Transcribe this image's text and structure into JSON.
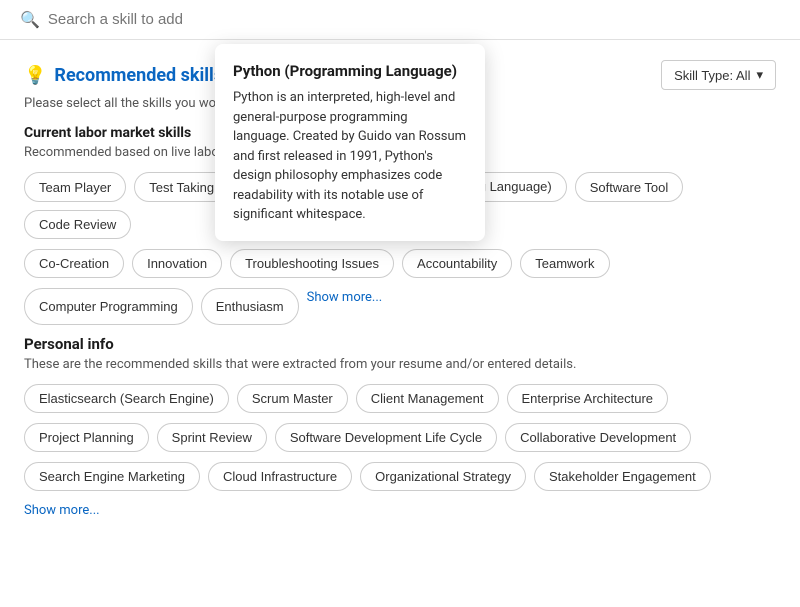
{
  "search": {
    "placeholder": "Search a skill to add"
  },
  "recommended": {
    "title": "Recommended skills",
    "desc_truncated": "Please select all the skills you wou...",
    "skill_type_label": "Skill Type: All",
    "labor_market": {
      "title": "Current labor market skills",
      "desc": "Recommended based on live labor..."
    },
    "tags": [
      "Team Player",
      "Test Taking",
      "Python (Programming Language)",
      "Software Tool",
      "Code Review",
      "Co-Creation",
      "Innovation",
      "Troubleshooting Issues",
      "Accountability",
      "Teamwork",
      "Computer Programming",
      "Enthusiasm"
    ],
    "show_more": "Show more..."
  },
  "personal_info": {
    "title": "Personal info",
    "desc": "These are the recommended skills that were extracted from your resume and/or entered details.",
    "tags": [
      "Elasticsearch (Search Engine)",
      "Scrum Master",
      "Client Management",
      "Enterprise Architecture",
      "Project Planning",
      "Sprint Review",
      "Software Development Life Cycle",
      "Collaborative Development",
      "Search Engine Marketing",
      "Cloud Infrastructure",
      "Organizational Strategy",
      "Stakeholder Engagement"
    ],
    "show_more": "Show more..."
  },
  "popover": {
    "title": "Python (Programming Language)",
    "body": "Python is an interpreted, high-level and general-purpose programming language. Created by Guido van Rossum and first released in 1991, Python's design philosophy emphasizes code readability with its notable use of significant whitespace."
  },
  "icons": {
    "search": "🔍",
    "bulb": "💡",
    "chevron_down": "▾"
  }
}
